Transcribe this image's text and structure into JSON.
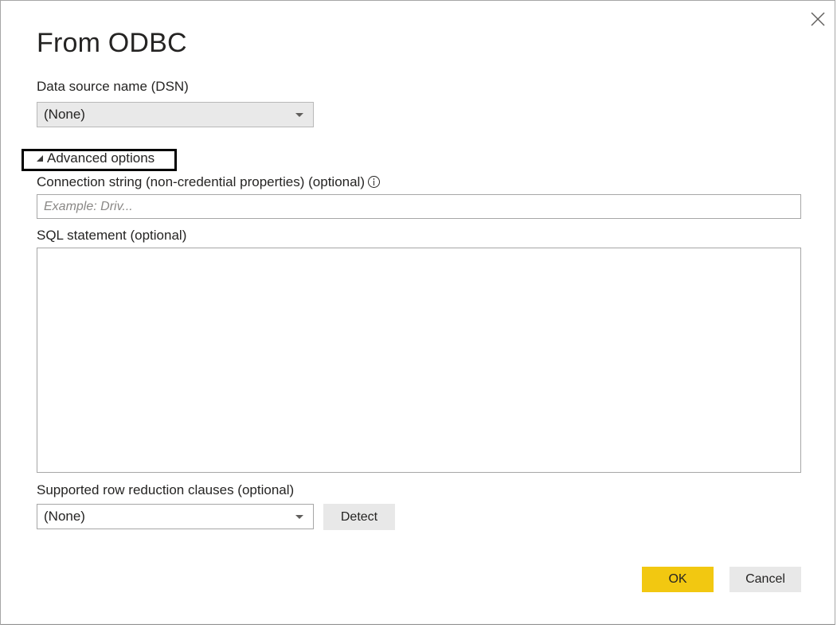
{
  "dialog": {
    "title": "From ODBC",
    "close_icon": "close-icon"
  },
  "dsn": {
    "label": "Data source name (DSN)",
    "selected": "(None)"
  },
  "advanced": {
    "toggle_label": "Advanced options",
    "expanded": true
  },
  "connection_string": {
    "label": "Connection string (non-credential properties) (optional)",
    "placeholder": "Example: Driv...",
    "value": "",
    "info_icon": "info-icon"
  },
  "sql": {
    "label": "SQL statement (optional)",
    "value": ""
  },
  "row_reduction": {
    "label": "Supported row reduction clauses (optional)",
    "selected": "(None)",
    "detect_label": "Detect"
  },
  "footer": {
    "ok_label": "OK",
    "cancel_label": "Cancel"
  },
  "colors": {
    "primary_button": "#f2c811",
    "secondary_button": "#e8e8e8",
    "disabled_field": "#e9e9e9",
    "border": "#a6a6a6",
    "highlight_box": "#000000"
  }
}
